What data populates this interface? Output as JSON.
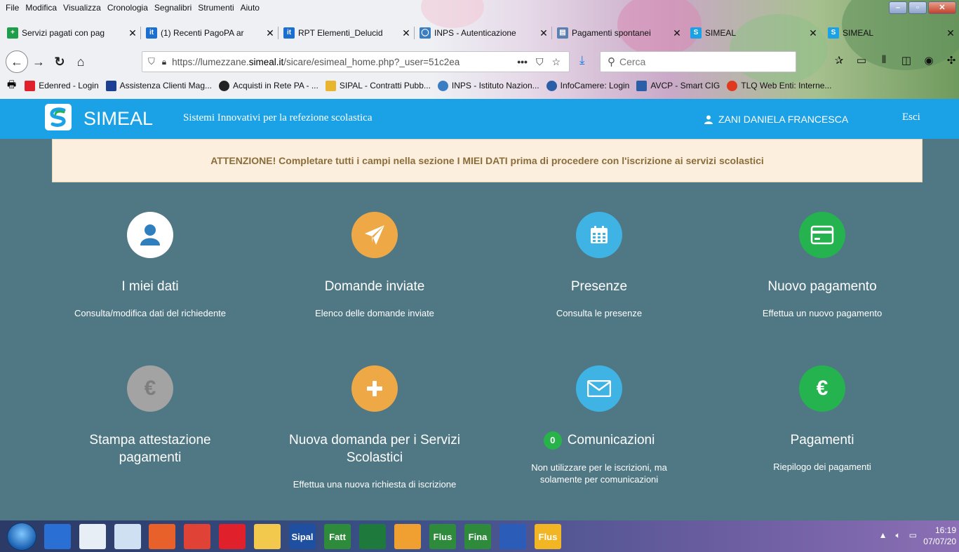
{
  "menubar": [
    "File",
    "Modifica",
    "Visualizza",
    "Cronologia",
    "Segnalibri",
    "Strumenti",
    "Aiuto"
  ],
  "tabs": [
    {
      "label": "Servizi pagati con pag",
      "icon": "plus-square-icon",
      "color": "#1e9e4a"
    },
    {
      "label": "(1) Recenti PagoPA ar",
      "icon": "it-icon",
      "color": "#1a6fd0"
    },
    {
      "label": "RPT Elementi_Delucid",
      "icon": "it-icon",
      "color": "#1a6fd0"
    },
    {
      "label": "INPS - Autenticazione",
      "icon": "inps-icon",
      "color": "#3b7dc2"
    },
    {
      "label": "Pagamenti spontanei",
      "icon": "page-icon",
      "color": "#5d7fb0"
    },
    {
      "label": "SIMEAL",
      "icon": "simeal-icon",
      "color": "#1ba1e6"
    },
    {
      "label": "SIMEAL",
      "icon": "simeal-icon",
      "color": "#1ba1e6"
    }
  ],
  "address": {
    "prefix": "https://lumezzane.",
    "domain": "simeal.it",
    "path": "/sicare/esimeal_home.php?_user=51c2ea",
    "more": "•••"
  },
  "search": {
    "placeholder": "Cerca"
  },
  "bookmarks": [
    {
      "label": "Edenred - Login",
      "color": "#e0202a"
    },
    {
      "label": "Assistenza Clienti Mag...",
      "color": "#1c3f93"
    },
    {
      "label": "Acquisti in Rete PA - ...",
      "color": "#222222"
    },
    {
      "label": "SIPAL - Contratti Pubb...",
      "color": "#e9b52c"
    },
    {
      "label": "INPS - Istituto Nazion...",
      "color": "#3b7dc2"
    },
    {
      "label": "InfoCamere: Login",
      "color": "#2a5fa8"
    },
    {
      "label": "AVCP - Smart CIG",
      "color": "#2a5fa8"
    },
    {
      "label": "TLQ Web Enti: Interne...",
      "color": "#e03a1e"
    }
  ],
  "header": {
    "brand": "SIMEAL",
    "tagline": "Sistemi Innovativi per la refezione scolastica",
    "user": "ZANI DANIELA FRANCESCA",
    "logout": "Esci",
    "color": "#1ba1e6"
  },
  "alert": {
    "text": "ATTENZIONE! Completare tutti i campi nella sezione I MIEI DATI prima di procedere con l'iscrizione ai servizi scolastici"
  },
  "tiles": [
    {
      "title": "I miei dati",
      "desc": "Consulta/modifica dati del richiedente",
      "icon": "user-icon",
      "color": "#ffffff"
    },
    {
      "title": "Domande inviate",
      "desc": "Elenco delle domande inviate",
      "icon": "paper-plane-icon",
      "color": "#efa846"
    },
    {
      "title": "Presenze",
      "desc": "Consulta le presenze",
      "icon": "calendar-icon",
      "color": "#3fb3e4"
    },
    {
      "title": "Nuovo pagamento",
      "desc": "Effettua un nuovo pagamento",
      "icon": "credit-card-icon",
      "color": "#24b34f"
    },
    {
      "title": "Stampa attestazione pagamenti",
      "desc": "",
      "icon": "euro-icon",
      "color": "#a3a3a3"
    },
    {
      "title": "Nuova domanda per i Servizi Scolastici",
      "desc": "Effettua una nuova richiesta di iscrizione",
      "icon": "plus-icon",
      "color": "#efa846"
    },
    {
      "title": "Comunicazioni",
      "badge": "0",
      "desc": "Non utilizzare per le iscrizioni, ma solamente per comunicazioni",
      "icon": "envelope-icon",
      "color": "#3fb3e4"
    },
    {
      "title": "Pagamenti",
      "desc": "Riepilogo dei pagamenti",
      "icon": "euro-icon",
      "color": "#24b34f"
    }
  ],
  "taskbar": {
    "apps": [
      {
        "label": "",
        "icon": "ie-icon",
        "color": "#2a6fd4"
      },
      {
        "label": "",
        "icon": "star-app-icon",
        "color": "#e8eef6"
      },
      {
        "label": "",
        "icon": "network-icon",
        "color": "#cfe0f2"
      },
      {
        "label": "",
        "icon": "firefox-icon",
        "color": "#e8602a"
      },
      {
        "label": "",
        "icon": "chrome-icon",
        "color": "#e04335"
      },
      {
        "label": "",
        "icon": "edenred-icon",
        "color": "#e0202a"
      },
      {
        "label": "",
        "icon": "folder-icon",
        "color": "#f2c94c"
      },
      {
        "label": "Sipal",
        "icon": "sipal-icon",
        "color": "#1e4fa0"
      },
      {
        "label": "Fatt",
        "icon": "fatt-icon",
        "color": "#2e8b3c"
      },
      {
        "label": "",
        "icon": "excel-icon",
        "color": "#1e7a3c"
      },
      {
        "label": "",
        "icon": "app-icon",
        "color": "#f0a030"
      },
      {
        "label": "Flus",
        "icon": "flus-icon",
        "color": "#2e8b3c"
      },
      {
        "label": "Fina",
        "icon": "fina-icon",
        "color": "#2e8b3c"
      },
      {
        "label": "",
        "icon": "word-icon",
        "color": "#2b5cb8"
      },
      {
        "label": "Flus",
        "icon": "flus-icon",
        "color": "#f2b624"
      }
    ],
    "time": "16:19",
    "date": "07/07/20"
  }
}
